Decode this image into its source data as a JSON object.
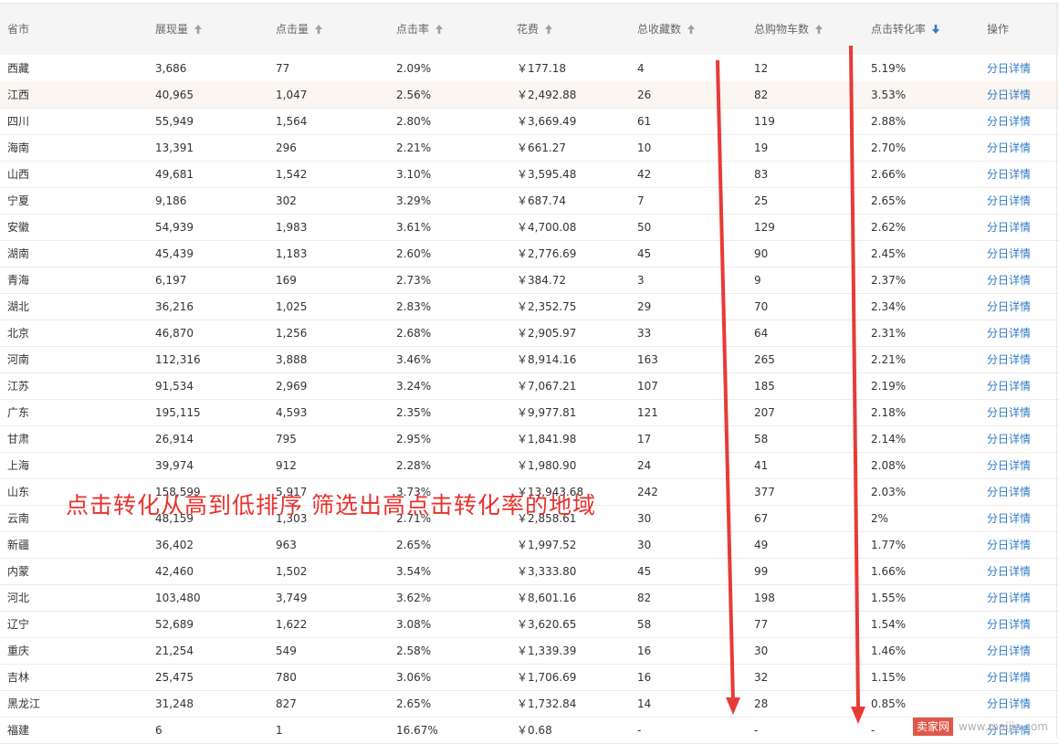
{
  "colors": {
    "header_bg": "#f5f5f5",
    "highlight_row": "#fbf6f1",
    "link": "#2f7ac8",
    "sort_active": "#2f7ac8",
    "sort_inactive": "#a0a0a0",
    "annotation": "#e8322e"
  },
  "table": {
    "columns": [
      {
        "label": "省市",
        "sort": "none"
      },
      {
        "label": "展现量",
        "sort": "up-gray"
      },
      {
        "label": "点击量",
        "sort": "up-gray"
      },
      {
        "label": "点击率",
        "sort": "up-gray"
      },
      {
        "label": "花费",
        "sort": "up-gray"
      },
      {
        "label": "总收藏数",
        "sort": "up-gray"
      },
      {
        "label": "总购物车数",
        "sort": "up-gray"
      },
      {
        "label": "点击转化率",
        "sort": "down-active"
      },
      {
        "label": "操作",
        "sort": "none"
      }
    ],
    "highlight_row_index": 1,
    "rows": [
      {
        "province": "西藏",
        "impressions": "3,686",
        "clicks": "77",
        "ctr": "2.09%",
        "cost": "￥177.18",
        "favorites": "4",
        "carts": "12",
        "cvr": "5.19%",
        "action": "分日详情"
      },
      {
        "province": "江西",
        "impressions": "40,965",
        "clicks": "1,047",
        "ctr": "2.56%",
        "cost": "￥2,492.88",
        "favorites": "26",
        "carts": "82",
        "cvr": "3.53%",
        "action": "分日详情"
      },
      {
        "province": "四川",
        "impressions": "55,949",
        "clicks": "1,564",
        "ctr": "2.80%",
        "cost": "￥3,669.49",
        "favorites": "61",
        "carts": "119",
        "cvr": "2.88%",
        "action": "分日详情"
      },
      {
        "province": "海南",
        "impressions": "13,391",
        "clicks": "296",
        "ctr": "2.21%",
        "cost": "￥661.27",
        "favorites": "10",
        "carts": "19",
        "cvr": "2.70%",
        "action": "分日详情"
      },
      {
        "province": "山西",
        "impressions": "49,681",
        "clicks": "1,542",
        "ctr": "3.10%",
        "cost": "￥3,595.48",
        "favorites": "42",
        "carts": "83",
        "cvr": "2.66%",
        "action": "分日详情"
      },
      {
        "province": "宁夏",
        "impressions": "9,186",
        "clicks": "302",
        "ctr": "3.29%",
        "cost": "￥687.74",
        "favorites": "7",
        "carts": "25",
        "cvr": "2.65%",
        "action": "分日详情"
      },
      {
        "province": "安徽",
        "impressions": "54,939",
        "clicks": "1,983",
        "ctr": "3.61%",
        "cost": "￥4,700.08",
        "favorites": "50",
        "carts": "129",
        "cvr": "2.62%",
        "action": "分日详情"
      },
      {
        "province": "湖南",
        "impressions": "45,439",
        "clicks": "1,183",
        "ctr": "2.60%",
        "cost": "￥2,776.69",
        "favorites": "45",
        "carts": "90",
        "cvr": "2.45%",
        "action": "分日详情"
      },
      {
        "province": "青海",
        "impressions": "6,197",
        "clicks": "169",
        "ctr": "2.73%",
        "cost": "￥384.72",
        "favorites": "3",
        "carts": "9",
        "cvr": "2.37%",
        "action": "分日详情"
      },
      {
        "province": "湖北",
        "impressions": "36,216",
        "clicks": "1,025",
        "ctr": "2.83%",
        "cost": "￥2,352.75",
        "favorites": "29",
        "carts": "70",
        "cvr": "2.34%",
        "action": "分日详情"
      },
      {
        "province": "北京",
        "impressions": "46,870",
        "clicks": "1,256",
        "ctr": "2.68%",
        "cost": "￥2,905.97",
        "favorites": "33",
        "carts": "64",
        "cvr": "2.31%",
        "action": "分日详情"
      },
      {
        "province": "河南",
        "impressions": "112,316",
        "clicks": "3,888",
        "ctr": "3.46%",
        "cost": "￥8,914.16",
        "favorites": "163",
        "carts": "265",
        "cvr": "2.21%",
        "action": "分日详情"
      },
      {
        "province": "江苏",
        "impressions": "91,534",
        "clicks": "2,969",
        "ctr": "3.24%",
        "cost": "￥7,067.21",
        "favorites": "107",
        "carts": "185",
        "cvr": "2.19%",
        "action": "分日详情"
      },
      {
        "province": "广东",
        "impressions": "195,115",
        "clicks": "4,593",
        "ctr": "2.35%",
        "cost": "￥9,977.81",
        "favorites": "121",
        "carts": "207",
        "cvr": "2.18%",
        "action": "分日详情"
      },
      {
        "province": "甘肃",
        "impressions": "26,914",
        "clicks": "795",
        "ctr": "2.95%",
        "cost": "￥1,841.98",
        "favorites": "17",
        "carts": "58",
        "cvr": "2.14%",
        "action": "分日详情"
      },
      {
        "province": "上海",
        "impressions": "39,974",
        "clicks": "912",
        "ctr": "2.28%",
        "cost": "￥1,980.90",
        "favorites": "24",
        "carts": "41",
        "cvr": "2.08%",
        "action": "分日详情"
      },
      {
        "province": "山东",
        "impressions": "158,599",
        "clicks": "5,917",
        "ctr": "3.73%",
        "cost": "￥13,943.68",
        "favorites": "242",
        "carts": "377",
        "cvr": "2.03%",
        "action": "分日详情"
      },
      {
        "province": "云南",
        "impressions": "48,159",
        "clicks": "1,303",
        "ctr": "2.71%",
        "cost": "￥2,858.61",
        "favorites": "30",
        "carts": "67",
        "cvr": "2%",
        "action": "分日详情"
      },
      {
        "province": "新疆",
        "impressions": "36,402",
        "clicks": "963",
        "ctr": "2.65%",
        "cost": "￥1,997.52",
        "favorites": "30",
        "carts": "49",
        "cvr": "1.77%",
        "action": "分日详情"
      },
      {
        "province": "内蒙",
        "impressions": "42,460",
        "clicks": "1,502",
        "ctr": "3.54%",
        "cost": "￥3,333.80",
        "favorites": "45",
        "carts": "99",
        "cvr": "1.66%",
        "action": "分日详情"
      },
      {
        "province": "河北",
        "impressions": "103,480",
        "clicks": "3,749",
        "ctr": "3.62%",
        "cost": "￥8,601.16",
        "favorites": "82",
        "carts": "198",
        "cvr": "1.55%",
        "action": "分日详情"
      },
      {
        "province": "辽宁",
        "impressions": "52,689",
        "clicks": "1,622",
        "ctr": "3.08%",
        "cost": "￥3,620.65",
        "favorites": "58",
        "carts": "77",
        "cvr": "1.54%",
        "action": "分日详情"
      },
      {
        "province": "重庆",
        "impressions": "21,254",
        "clicks": "549",
        "ctr": "2.58%",
        "cost": "￥1,339.39",
        "favorites": "16",
        "carts": "30",
        "cvr": "1.46%",
        "action": "分日详情"
      },
      {
        "province": "吉林",
        "impressions": "25,475",
        "clicks": "780",
        "ctr": "3.06%",
        "cost": "￥1,706.69",
        "favorites": "16",
        "carts": "32",
        "cvr": "1.15%",
        "action": "分日详情"
      },
      {
        "province": "黑龙江",
        "impressions": "31,248",
        "clicks": "827",
        "ctr": "2.65%",
        "cost": "￥1,732.84",
        "favorites": "14",
        "carts": "28",
        "cvr": "0.85%",
        "action": "分日详情"
      },
      {
        "province": "福建",
        "impressions": "6",
        "clicks": "1",
        "ctr": "16.67%",
        "cost": "￥0.68",
        "favorites": "-",
        "carts": "-",
        "cvr": "-",
        "action": "分日详情"
      }
    ]
  },
  "annotation": {
    "text": "点击转化从高到低排序  筛选出高点击转化率的地域"
  },
  "watermark": {
    "brand": "卖家网",
    "url": "www.maijia.com"
  }
}
